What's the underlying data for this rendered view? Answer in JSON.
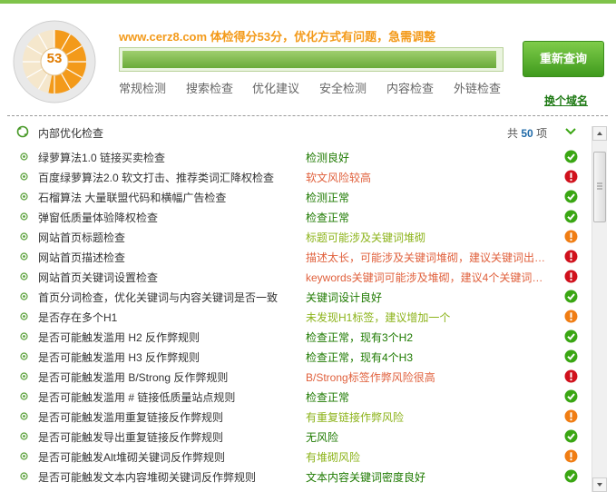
{
  "header": {
    "score": "53",
    "score_fraction": 0.53,
    "headline": "www.cerz8.com 体检得分53分，优化方式有问题，急需调整",
    "progress_fraction": 0.99,
    "recheck_label": "重新查询",
    "change_domain_label": "换个域名",
    "tabs": [
      {
        "label": "常规检测"
      },
      {
        "label": "搜索检查"
      },
      {
        "label": "优化建议"
      },
      {
        "label": "安全检测"
      },
      {
        "label": "内容检查"
      },
      {
        "label": "外链检查"
      }
    ]
  },
  "section": {
    "title": "内部优化检查",
    "count_prefix": "共",
    "count_value": "50",
    "count_suffix": "项"
  },
  "colors": {
    "ok": "#3aa613",
    "error": "#d0111c",
    "warn": "#f07d13",
    "text_green": "#1e7a00",
    "text_red": "#e0603c",
    "text_olive": "#8cb31a",
    "brand_orange": "#f39a1a"
  },
  "items": [
    {
      "name": "绿萝算法1.0 链接买卖检查",
      "result": "检测良好",
      "status": "ok",
      "icon": "check-icon"
    },
    {
      "name": "百度绿萝算法2.0 软文打击、推荐类词汇降权检查",
      "result": "软文风险较高",
      "status": "error",
      "icon": "exclamation-icon"
    },
    {
      "name": "石榴算法 大量联盟代码和横幅广告检查",
      "result": "检测正常",
      "status": "ok",
      "icon": "check-icon"
    },
    {
      "name": "弹窗低质量体验降权检查",
      "result": "检查正常",
      "status": "ok",
      "icon": "check-icon"
    },
    {
      "name": "网站首页标题检查",
      "result": "标题可能涉及关键词堆砌",
      "status": "warn",
      "icon": "exclamation-icon"
    },
    {
      "name": "网站首页描述检查",
      "result": "描述太长，可能涉及关键词堆砌，建议关键词出…",
      "status": "error",
      "icon": "exclamation-icon"
    },
    {
      "name": "网站首页关键词设置检查",
      "result": "keywords关键词可能涉及堆砌，建议4个关键词以内",
      "status": "error",
      "icon": "exclamation-icon"
    },
    {
      "name": "首页分词检查，优化关键词与内容关键词是否一致",
      "result": "关键词设计良好",
      "status": "ok",
      "icon": "check-icon"
    },
    {
      "name": "是否存在多个H1",
      "result": "未发现H1标签，建议增加一个",
      "status": "warn",
      "icon": "exclamation-icon"
    },
    {
      "name": "是否可能触发滥用 H2 反作弊规则",
      "result": "检查正常，现有3个H2",
      "status": "ok",
      "icon": "check-icon"
    },
    {
      "name": "是否可能触发滥用 H3 反作弊规则",
      "result": "检查正常，现有4个H3",
      "status": "ok",
      "icon": "check-icon"
    },
    {
      "name": "是否可能触发滥用 B/Strong 反作弊规则",
      "result": "B/Strong标签作弊风险很高",
      "status": "error",
      "icon": "exclamation-icon"
    },
    {
      "name": "是否可能触发滥用 # 链接低质量站点规则",
      "result": "检查正常",
      "status": "ok",
      "icon": "check-icon"
    },
    {
      "name": "是否可能触发滥用重复链接反作弊规则",
      "result": "有重复链接作弊风险",
      "status": "warn",
      "icon": "exclamation-icon"
    },
    {
      "name": "是否可能触发导出重复链接反作弊规则",
      "result": "无风险",
      "status": "ok",
      "icon": "check-icon"
    },
    {
      "name": "是否可能触发Alt堆砌关键词反作弊规则",
      "result": "有堆砌风险",
      "status": "warn",
      "icon": "exclamation-icon"
    },
    {
      "name": "是否可能触发文本内容堆砌关键词反作弊规则",
      "result": "文本内容关键词密度良好",
      "status": "ok",
      "icon": "check-icon"
    }
  ]
}
